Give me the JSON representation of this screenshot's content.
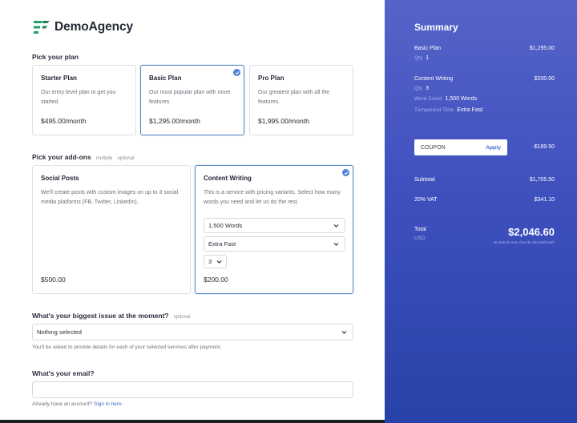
{
  "brand": {
    "name": "DemoAgency",
    "mark_color": "#22a06b"
  },
  "plan_section": {
    "label": "Pick your plan"
  },
  "plans": [
    {
      "title": "Starter Plan",
      "description": "Our entry level plan to get you started.",
      "price": "$495.00/month",
      "selected": false
    },
    {
      "title": "Basic Plan",
      "description": "Our most popular plan with more features.",
      "price": "$1,295.00/month",
      "selected": true
    },
    {
      "title": "Pro Plan",
      "description": "Our greatest plan with all the features.",
      "price": "$1,995.00/month",
      "selected": false
    }
  ],
  "addons_section": {
    "label": "Pick your add-ons",
    "tag_multiple": "multiple",
    "tag_optional": "optional"
  },
  "addons": [
    {
      "title": "Social Posts",
      "description": "We'll create posts with custom images on up to 3 social media platforms (FB, Twitter, LinkedIn).",
      "price": "$500.00",
      "selected": false
    },
    {
      "title": "Content Writing",
      "description": "This is a service with pricing variants. Select how many words you need and let us do the rest.",
      "price": "$200.00",
      "selected": true,
      "words_select": "1,500 Words",
      "turnaround_select": "Extra Fast",
      "qty_select": "3"
    }
  ],
  "issue": {
    "label": "What's your biggest issue at the moment?",
    "tag": "optional",
    "value": "Nothing selected",
    "helper": "You'll be asked to provide details for each of your selected services after payment."
  },
  "email": {
    "label": "What's your email?",
    "value": "",
    "account_text": "Already have an account?",
    "sign_in": "Sign in here."
  },
  "summary": {
    "title": "Summary",
    "basic": {
      "name": "Basic Plan",
      "price": "$1,295.00",
      "qty_label": "Qty",
      "qty": "1"
    },
    "content": {
      "name": "Content Writing",
      "price": "$200.00",
      "qty_label": "Qty",
      "qty": "3",
      "wc_label": "Word Count",
      "wc": "1,500 Words",
      "ta_label": "Turnaround Time",
      "ta": "Extra Fast"
    },
    "coupon": {
      "code": "COUPON",
      "apply": "Apply",
      "discount": "-$189.50"
    },
    "subtotal": {
      "label": "Subtotal",
      "value": "$1,705.50"
    },
    "vat": {
      "label": "20% VAT",
      "value": "$341.10"
    },
    "total": {
      "label": "Total",
      "currency": "USD",
      "value": "$2,046.60",
      "note": "$2,046.60 now, then $1,554.00/month"
    }
  },
  "colors": {
    "accent": "#4f83d6",
    "summary_bg_top": "#5663c9",
    "summary_bg_bottom": "#2742a8",
    "link": "#3b6fcf"
  }
}
